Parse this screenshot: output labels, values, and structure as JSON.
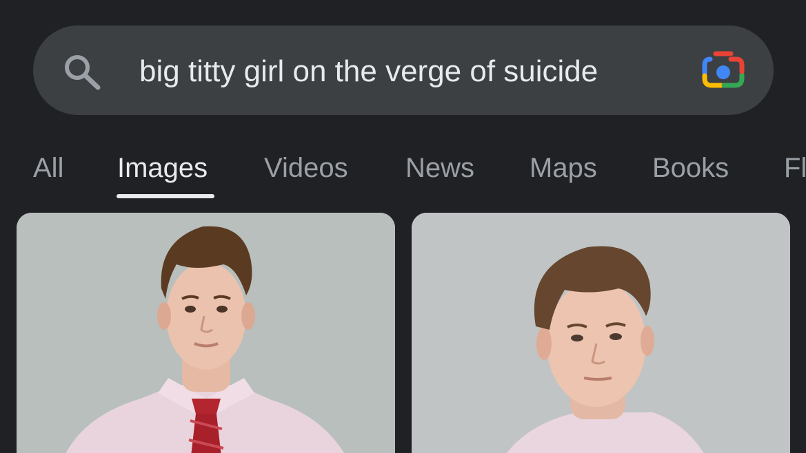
{
  "search": {
    "query": "big titty girl on the verge of suicide",
    "icon": "search-icon",
    "lens_icon": "google-lens-camera-icon"
  },
  "tabs": [
    {
      "label": "All",
      "active": false
    },
    {
      "label": "Images",
      "active": true
    },
    {
      "label": "Videos",
      "active": false
    },
    {
      "label": "News",
      "active": false
    },
    {
      "label": "Maps",
      "active": false
    },
    {
      "label": "Books",
      "active": false
    },
    {
      "label": "Fl",
      "active": false
    }
  ],
  "results": [
    {
      "subject": "man-in-pink-shirt-red-tie"
    },
    {
      "subject": "man-in-pink-shirt"
    }
  ],
  "colors": {
    "background": "#202124",
    "search_bar": "#3c4043",
    "text_primary": "#e8eaed",
    "text_secondary": "#9aa0a6"
  }
}
